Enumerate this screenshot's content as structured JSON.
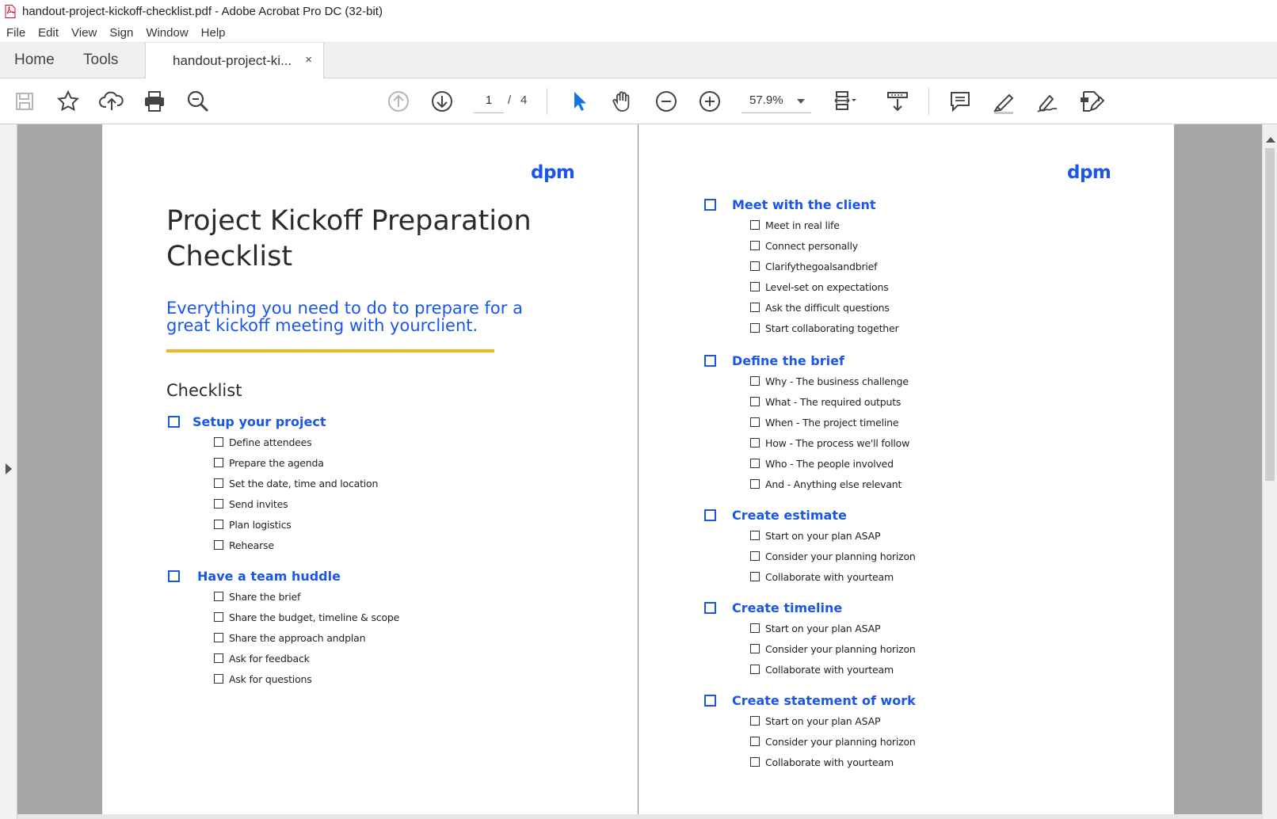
{
  "window": {
    "title": "handout-project-kickoff-checklist.pdf - Adobe Acrobat Pro DC (32-bit)"
  },
  "menu": [
    "File",
    "Edit",
    "View",
    "Sign",
    "Window",
    "Help"
  ],
  "tabs": {
    "home": "Home",
    "tools": "Tools",
    "document": "handout-project-ki...",
    "close": "×"
  },
  "toolbar": {
    "page_current": "1",
    "page_separator": "/",
    "page_total": "4",
    "zoom": "57.9%",
    "icons": [
      "save-icon",
      "bookmark-star-icon",
      "cloud-upload-icon",
      "print-icon",
      "find-zoom-icon",
      "prev-page-icon",
      "next-page-icon",
      "select-cursor-icon",
      "hand-tool-icon",
      "zoom-out-icon",
      "zoom-in-icon",
      "page-fit-icon",
      "scroll-mode-icon",
      "comment-icon",
      "highlight-icon",
      "sign-icon",
      "edit-pdf-icon"
    ]
  },
  "page1": {
    "logo": "dpm",
    "title": "Project Kickoff Preparation Checklist",
    "subtitle": "Everything you  need to do to prepare for a great kickoff meeting with yourclient.",
    "heading": "Checklist",
    "sections": [
      {
        "title": "Setup your project",
        "items": [
          "Define attendees",
          "Prepare the agenda",
          "Set the date, time and location",
          "Send invites",
          "Plan logistics",
          "Rehearse"
        ]
      },
      {
        "title": "Have a team huddle",
        "items": [
          "Share the brief",
          "Share the budget, timeline & scope",
          "Share the approach andplan",
          "Ask for feedback",
          "Ask for questions"
        ]
      }
    ]
  },
  "page2": {
    "logo": "dpm",
    "sections": [
      {
        "title": "Meet with the client",
        "items": [
          "Meet in real life",
          "Connect personally",
          "Clarifythegoalsandbrief",
          "Level-set on expectations",
          "Ask the difficult questions",
          "Start collaborating together"
        ]
      },
      {
        "title": "Define the brief",
        "items": [
          "Why - The business challenge",
          "What - The required outputs",
          "When - The project timeline",
          "How - The process we'll follow",
          "Who - The people involved",
          "And - Anything else relevant"
        ]
      },
      {
        "title": "Create estimate",
        "items": [
          "Start on your plan ASAP",
          "Consider your planning horizon",
          "Collaborate with yourteam"
        ]
      },
      {
        "title": "Create timeline",
        "items": [
          "Start on your plan ASAP",
          "Consider your planning horizon",
          "Collaborate with yourteam"
        ]
      },
      {
        "title": "Create statement of work",
        "items": [
          "Start on your plan ASAP",
          "Consider your planning horizon",
          "Collaborate with yourteam"
        ]
      }
    ]
  }
}
